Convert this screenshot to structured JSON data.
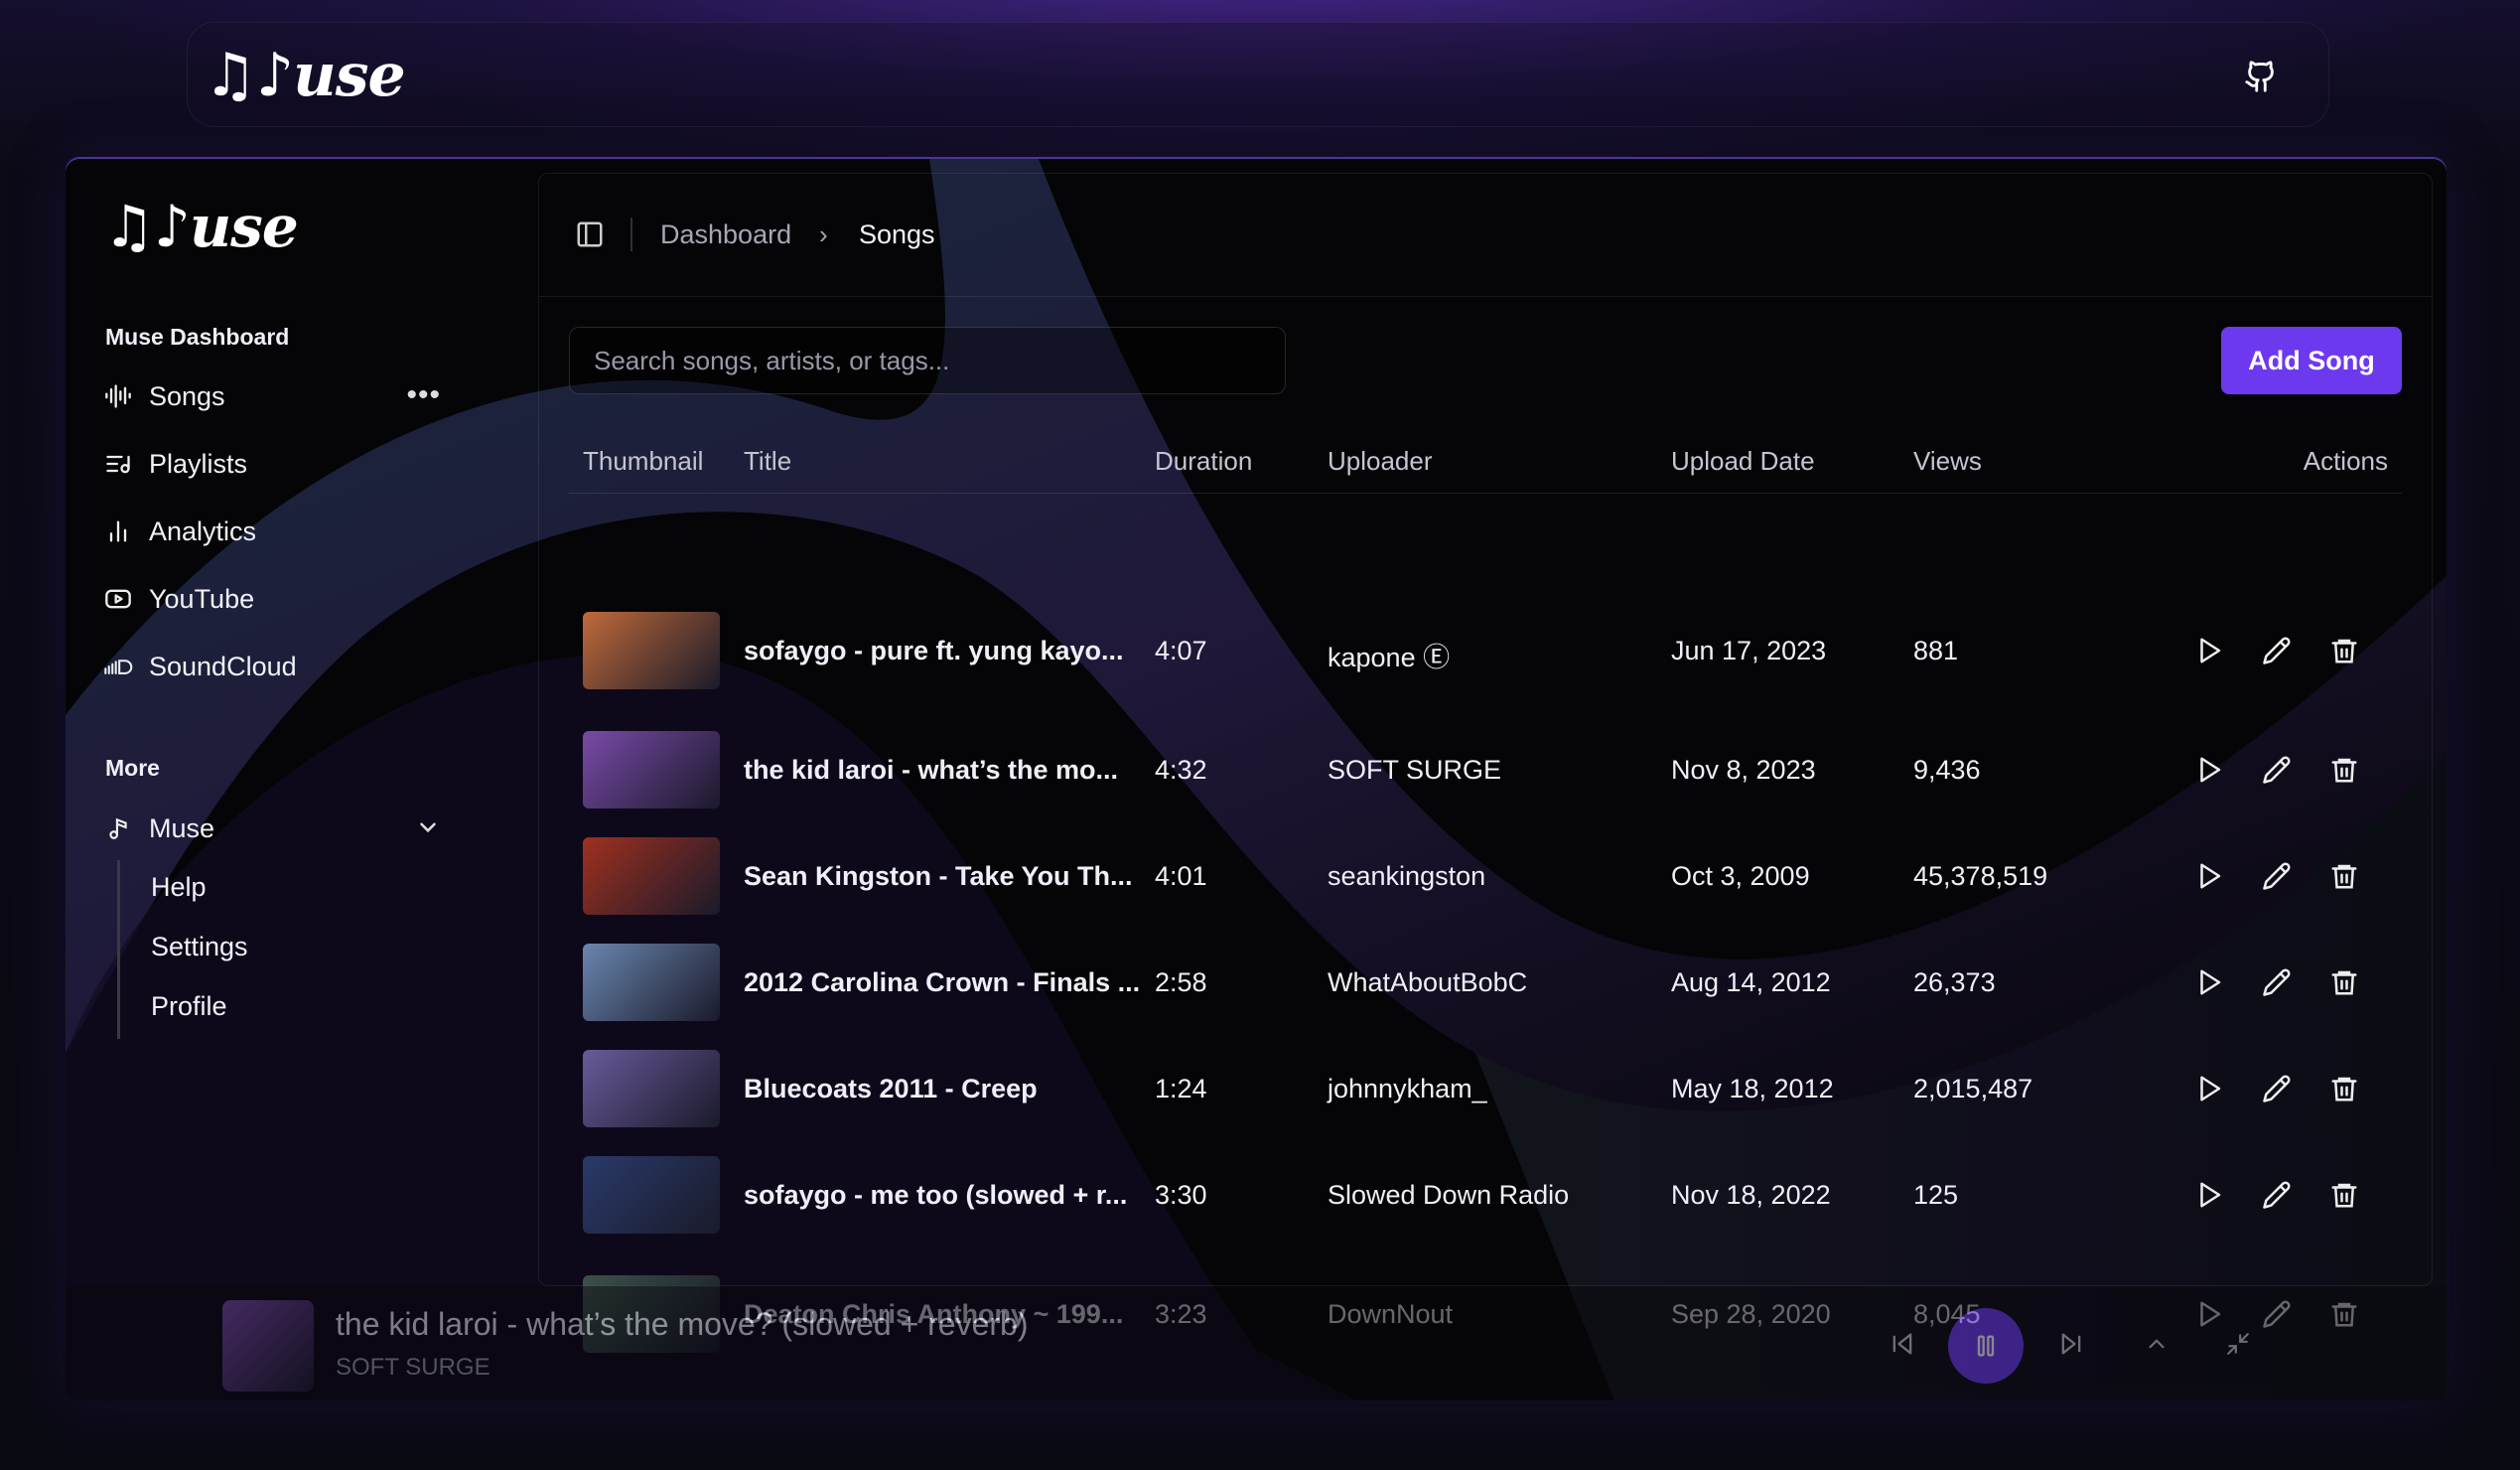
{
  "app": {
    "name": "Muse"
  },
  "topbar": {
    "logo": "♫♪use",
    "github_icon": "github-icon"
  },
  "sidebar": {
    "logo": "♫♪use",
    "group_label": "Muse Dashboard",
    "items": [
      {
        "label": "Songs",
        "icon": "audio-waveform-icon"
      },
      {
        "label": "Playlists",
        "icon": "list-music-icon"
      },
      {
        "label": "Analytics",
        "icon": "bar-chart-icon"
      },
      {
        "label": "YouTube",
        "icon": "youtube-icon"
      },
      {
        "label": "SoundCloud",
        "icon": "soundcloud-icon"
      }
    ],
    "songs_more": "•••",
    "more_label": "More",
    "muse_section": {
      "label": "Muse",
      "icon": "music-note-icon"
    },
    "sub_items": [
      "Help",
      "Settings",
      "Profile"
    ]
  },
  "header": {
    "breadcrumb": [
      "Dashboard",
      "Songs"
    ],
    "separator": "›"
  },
  "search": {
    "placeholder": "Search songs, artists, or tags..."
  },
  "add_button": "Add Song",
  "table": {
    "columns": [
      "Thumbnail",
      "Title",
      "Duration",
      "Uploader",
      "Upload Date",
      "Views",
      "Actions"
    ],
    "rows": [
      {
        "title": "sofaygo - pure ft. yung kayo...",
        "duration": "4:07",
        "uploader": "kapone Ⓔ",
        "date": "Jun 17, 2023",
        "views": "881",
        "thumb_color": "#c06a3a"
      },
      {
        "title": "the kid laroi - what’s the mo...",
        "duration": "4:32",
        "uploader": "SOFT SURGE",
        "date": "Nov 8, 2023",
        "views": "9,436",
        "thumb_color": "#7a4aa8"
      },
      {
        "title": "Sean Kingston - Take You Th...",
        "duration": "4:01",
        "uploader": "seankingston",
        "date": "Oct 3, 2009",
        "views": "45,378,519",
        "thumb_color": "#a03020"
      },
      {
        "title": "2012 Carolina Crown - Finals ...",
        "duration": "2:58",
        "uploader": "WhatAboutBobC",
        "date": "Aug 14, 2012",
        "views": "26,373",
        "thumb_color": "#6a86b0"
      },
      {
        "title": "Bluecoats 2011 - Creep",
        "duration": "1:24",
        "uploader": "johnnykham_",
        "date": "May 18, 2012",
        "views": "2,015,487",
        "thumb_color": "#6a5a9a"
      },
      {
        "title": "sofaygo - me too (slowed + r...",
        "duration": "3:30",
        "uploader": "Slowed Down Radio",
        "date": "Nov 18, 2022",
        "views": "125",
        "thumb_color": "#2a3a6a"
      },
      {
        "title": "Deaton Chris Anthony ~ 199...",
        "duration": "3:23",
        "uploader": "DownNout",
        "date": "Sep 28, 2020",
        "views": "8,045",
        "thumb_color": "#4a6a5a"
      }
    ]
  },
  "player": {
    "title": "the kid laroi - what’s the move? (slowed + reverb)",
    "artist": "SOFT SURGE",
    "thumb_color": "#7a4aa8"
  },
  "colors": {
    "accent": "#6d39ef",
    "background": "#050507"
  }
}
